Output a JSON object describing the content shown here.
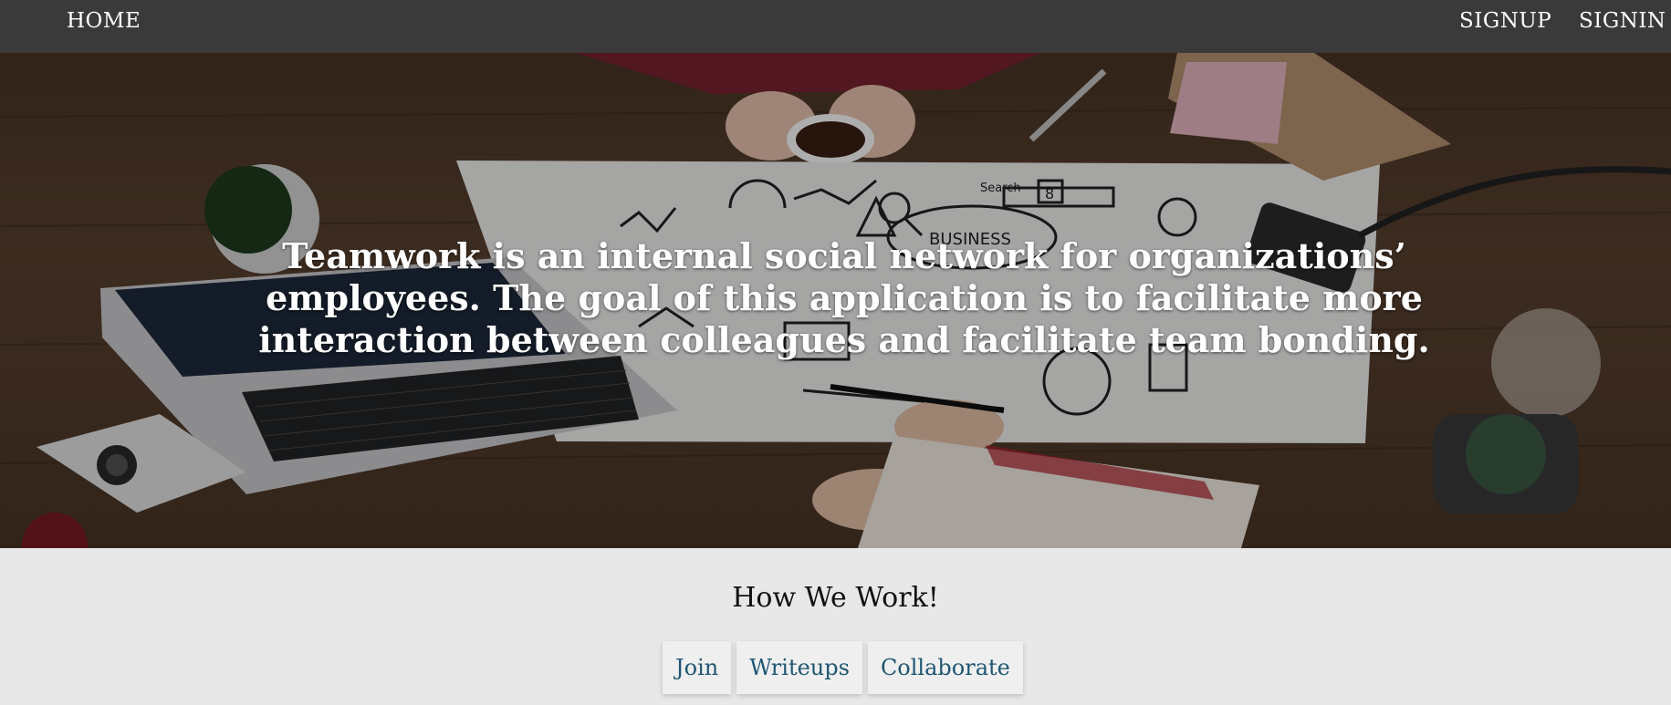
{
  "nav": {
    "home": "HOME",
    "signup": "SIGNUP",
    "signin": "SIGNIN"
  },
  "hero": {
    "line1": "Teamwork is an internal social network for organizations’",
    "line2": "employees. The goal of this application is to facilitate more",
    "line3": "interaction between colleagues and facilitate team bonding.",
    "sketch_label": "BUSINESS",
    "sketch_search": "Search",
    "sketch_number": "8"
  },
  "section": {
    "title": "How We Work!",
    "tabs": [
      "Join",
      "Writeups",
      "Collaborate"
    ]
  },
  "colors": {
    "nav_bg": "#3a3a3a",
    "tab_text": "#1e5672",
    "section_bg": "#e8e8e8"
  }
}
